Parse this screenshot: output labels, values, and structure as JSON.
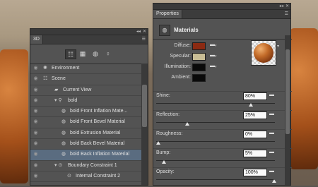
{
  "panel3d": {
    "tab": "3D",
    "toolbar": [
      {
        "icon": "scene-filter-icon",
        "glyph": "☷",
        "selected": true
      },
      {
        "icon": "mesh-filter-icon",
        "glyph": "▦",
        "selected": false
      },
      {
        "icon": "material-filter-icon",
        "glyph": "◍",
        "selected": false
      },
      {
        "icon": "light-filter-icon",
        "glyph": "♀",
        "selected": false
      }
    ],
    "rows": [
      {
        "label": "Environment",
        "glyph": "✺",
        "indent": 0
      },
      {
        "label": "Scene",
        "glyph": "☷",
        "indent": 0
      },
      {
        "label": "Current View",
        "glyph": "▰",
        "indent": 1
      },
      {
        "label": "bold",
        "glyph": "▾ ⚲",
        "indent": 1
      },
      {
        "label": "bold Front Inflation Mate...",
        "glyph": "◍",
        "indent": 2
      },
      {
        "label": "bold Front Bevel Material",
        "glyph": "◍",
        "indent": 2
      },
      {
        "label": "bold Extrusion Material",
        "glyph": "◍",
        "indent": 2
      },
      {
        "label": "bold Back Bevel Material",
        "glyph": "◍",
        "indent": 2
      },
      {
        "label": "bold Back Inflation Material",
        "glyph": "◍",
        "indent": 2,
        "selected": true
      },
      {
        "label": "Boundary Constraint 1",
        "glyph": "▾ ⊙",
        "indent": 1
      },
      {
        "label": "Internal Constraint 2",
        "glyph": "⊙",
        "indent": 3
      }
    ]
  },
  "properties": {
    "tab": "Properties",
    "section_title": "Materials",
    "colors": [
      {
        "label": "Diffuse:",
        "swatch": "#8b2a12"
      },
      {
        "label": "Specular:",
        "swatch": "#c8bd95"
      },
      {
        "label": "Illumination:",
        "swatch": "#0a0a0a"
      },
      {
        "label": "Ambient:",
        "swatch": "#0a0a0a"
      }
    ],
    "params": [
      {
        "label": "Shine:",
        "value": "80%",
        "level": 0.8
      },
      {
        "label": "Reflection:",
        "value": "25%",
        "level": 0.25
      },
      {
        "label": "Roughness:",
        "value": "0%",
        "level": 0.0
      },
      {
        "label": "Bump:",
        "value": "5%",
        "level": 0.05
      },
      {
        "label": "Opacity:",
        "value": "100%",
        "level": 1.0
      }
    ]
  }
}
